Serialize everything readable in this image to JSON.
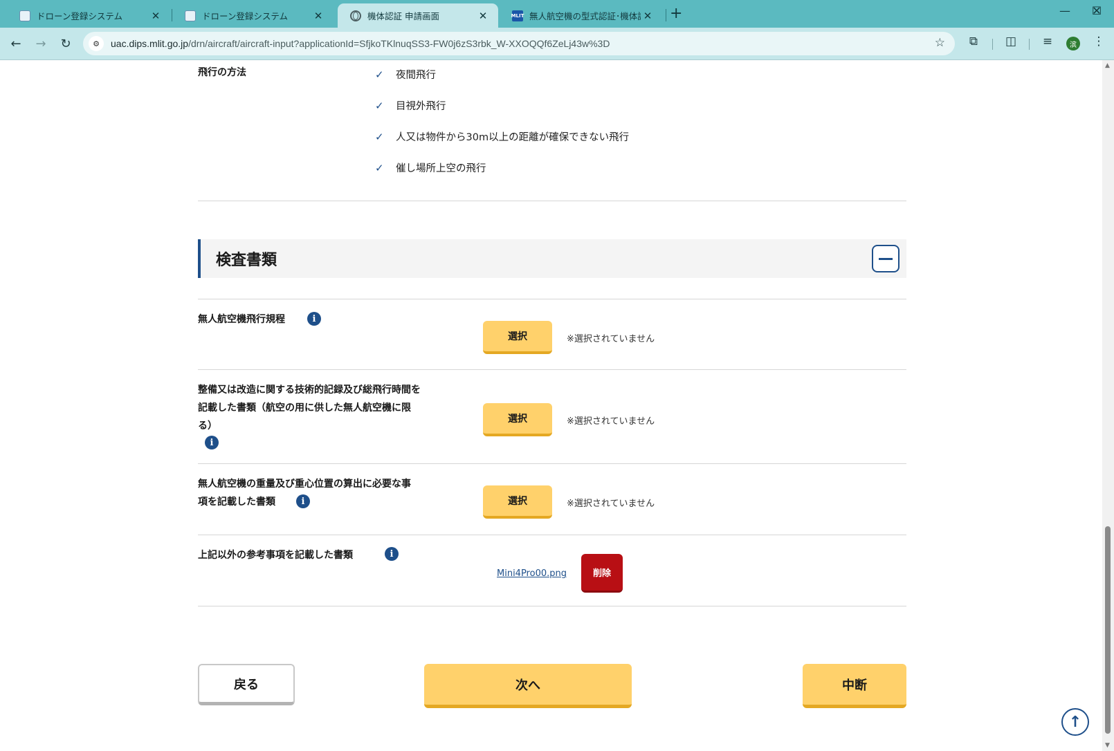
{
  "browser": {
    "tabs": [
      {
        "title": "ドローン登録システム",
        "icon": "drone-favicon"
      },
      {
        "title": "ドローン登録システム",
        "icon": "drone-favicon"
      },
      {
        "title": "機体認証 申請画面",
        "icon": "globe-favicon",
        "active": true
      },
      {
        "title": "無人航空機の型式認証･機体認証",
        "icon": "mlit-favicon"
      }
    ],
    "new_tab": "+",
    "close_glyph": "✕",
    "url_host": "uac.dips.mlit.go.jp",
    "url_path": "/drn/aircraft/aircraft-input?applicationId=SfjkoTKlnuqSS3-FW0j6zS3rbk_W-XXOQQf6ZeLj43w%3D",
    "profile_initial": "滨"
  },
  "flight_method": {
    "label": "飛行の方法",
    "items": [
      "夜間飛行",
      "目視外飛行",
      "人又は物件から30m以上の距離が確保できない飛行",
      "催し場所上空の飛行"
    ]
  },
  "inspection": {
    "title": "検査書類",
    "rows": [
      {
        "label": "無人航空機飛行規程",
        "button": "選択",
        "status": "※選択されていません"
      },
      {
        "label": "整備又は改造に関する技術的記録及び総飛行時間を記載した書類（航空の用に供した無人航空機に限る）",
        "label_lines": [
          "整備又は改造に関する技術的記録及び総飛行時間を",
          "記載した書類（航空の用に供した無人航空機に限",
          "る）"
        ],
        "button": "選択",
        "status": "※選択されていません"
      },
      {
        "label": "無人航空機の重量及び重心位置の算出に必要な事項を記載した書類",
        "label_lines": [
          "無人航空機の重量及び重心位置の算出に必要な事",
          "項を記載した書類"
        ],
        "button": "選択",
        "status": "※選択されていません"
      },
      {
        "label": "上記以外の参考事項を記載した書類",
        "file": "Mini4Pro00.png",
        "delete_button": "削除"
      }
    ]
  },
  "footer": {
    "back": "戻る",
    "next": "次へ",
    "suspend": "中断"
  },
  "colors": {
    "accent": "#1e4f8a",
    "button_yellow": "#ffd16b",
    "delete_red": "#b80f14",
    "tabbar": "#5bbac0"
  }
}
